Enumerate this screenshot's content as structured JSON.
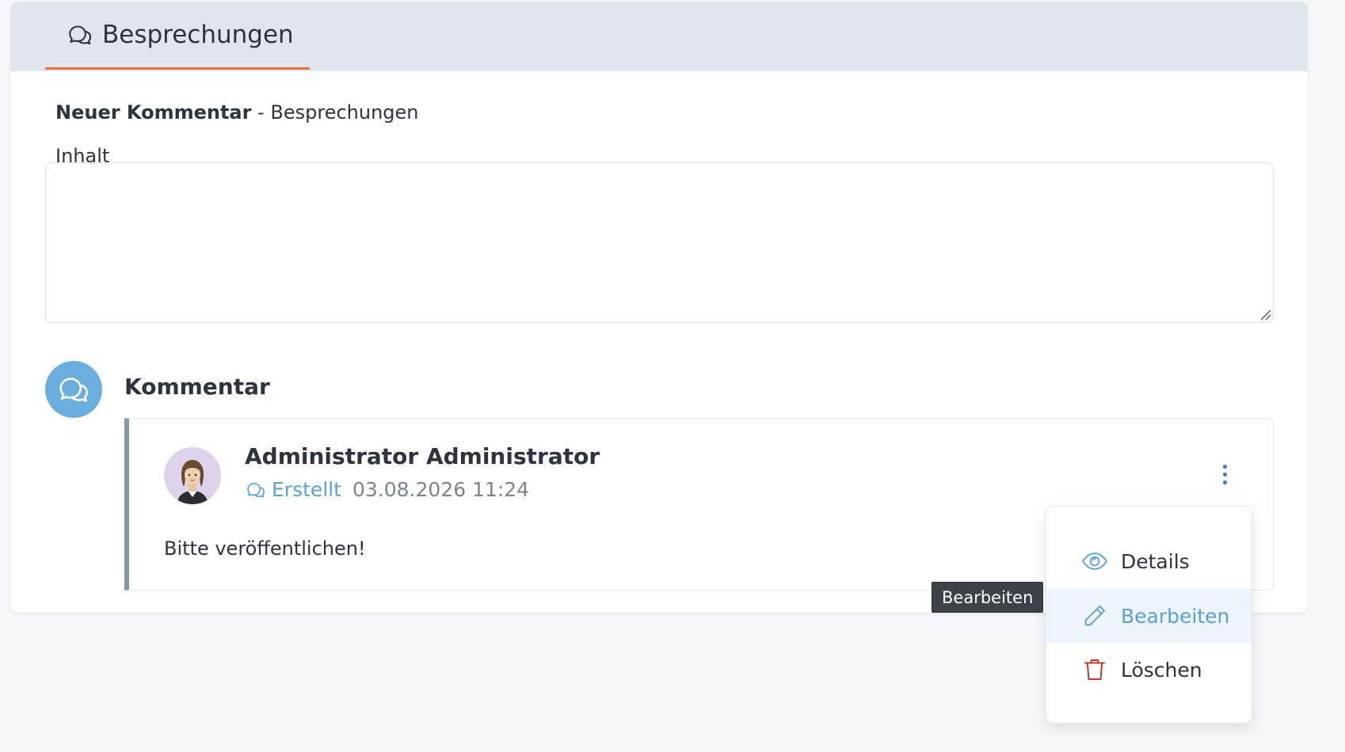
{
  "tab": {
    "label": "Besprechungen",
    "icon": "chat-bubbles-icon",
    "underline_color": "#e9733a"
  },
  "form": {
    "title_bold": "Neuer Kommentar",
    "title_separator": " - ",
    "title_context": "Besprechungen",
    "content_label": "Inhalt",
    "content_value": "",
    "content_placeholder": ""
  },
  "section": {
    "title": "Kommentar",
    "icon": "chat-bubbles-icon",
    "icon_bg": "#6aaee0"
  },
  "comment": {
    "author": "Administrator Administrator",
    "avatar": "user-avatar",
    "status": "Erstellt",
    "status_icon": "chat-bubbles-icon",
    "datetime": "03.08.2026 11:24",
    "body": "Bitte veröffentlichen!"
  },
  "menu": {
    "trigger_icon": "kebab-menu-icon",
    "items": [
      {
        "label": "Details",
        "icon": "eye-icon"
      },
      {
        "label": "Bearbeiten",
        "icon": "pencil-icon",
        "highlighted": true
      },
      {
        "label": "Löschen",
        "icon": "trash-icon",
        "color": "#c0392b"
      }
    ]
  },
  "tooltip": {
    "text": "Bearbeiten"
  },
  "colors": {
    "accent_blue": "#5aa2d8",
    "danger_red": "#c0392b",
    "header_bg": "#e1e5ec"
  }
}
